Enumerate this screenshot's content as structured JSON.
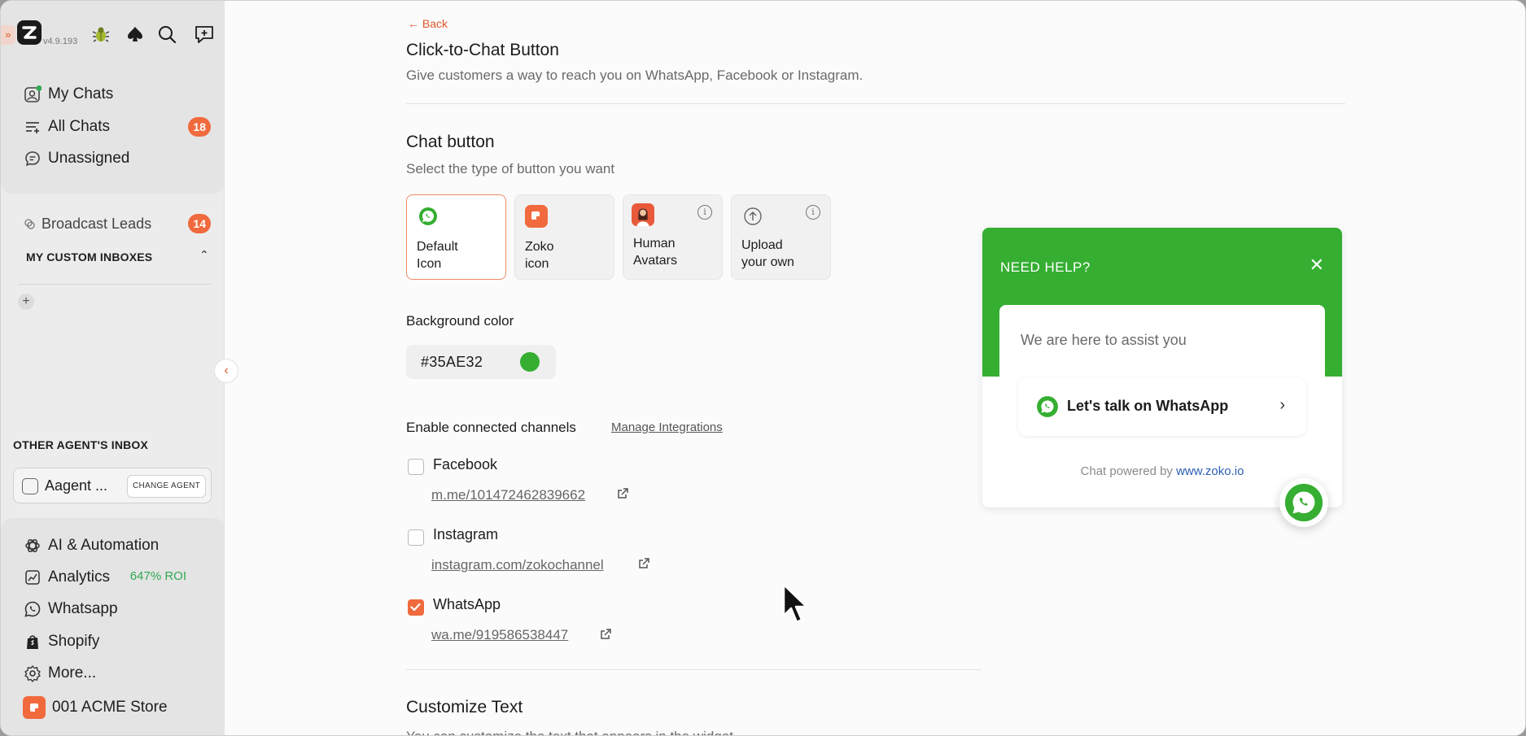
{
  "app": {
    "version": "v4.9.193"
  },
  "sidebar": {
    "primary": [
      {
        "label": "My Chats",
        "icon": "person-chat-icon"
      },
      {
        "label": "All Chats",
        "icon": "list-filter-icon",
        "badge": "18"
      },
      {
        "label": "Unassigned",
        "icon": "chat-bubble-icon"
      }
    ],
    "broadcast": {
      "label": "Broadcast Leads",
      "badge": "14"
    },
    "custom_inboxes_label": "MY CUSTOM INBOXES",
    "other_agent_label": "OTHER AGENT'S INBOX",
    "agent": {
      "name": "Aagent ...",
      "change_label": "CHANGE AGENT"
    },
    "bottom": [
      {
        "label": "AI & Automation",
        "icon": "openai-icon"
      },
      {
        "label": "Analytics",
        "icon": "chart-line-icon",
        "extra": "647% ROI"
      },
      {
        "label": "Whatsapp",
        "icon": "whatsapp-icon"
      },
      {
        "label": "Shopify",
        "icon": "shopify-bag-icon"
      },
      {
        "label": "More...",
        "icon": "gear-icon"
      }
    ],
    "store": {
      "label": "001 ACME Store"
    }
  },
  "page": {
    "back_label": "Back",
    "title": "Click-to-Chat Button",
    "subtitle": "Give customers a way to reach you on WhatsApp, Facebook or Instagram."
  },
  "chat_button": {
    "heading": "Chat button",
    "subheading": "Select the type of button you want",
    "types": [
      {
        "line1": "Default",
        "line2": "Icon",
        "selected": true
      },
      {
        "line1": "Zoko",
        "line2": "icon",
        "selected": false
      },
      {
        "line1": "Human",
        "line2": "Avatars",
        "selected": false
      },
      {
        "line1": "Upload",
        "line2": "your own",
        "selected": false
      }
    ]
  },
  "background": {
    "label": "Background color",
    "value": "#35AE32"
  },
  "channels": {
    "label": "Enable connected channels",
    "manage_label": "Manage Integrations",
    "items": [
      {
        "name": "Facebook",
        "link": "m.me/101472462839662",
        "checked": false
      },
      {
        "name": "Instagram",
        "link": "instagram.com/zokochannel",
        "checked": false
      },
      {
        "name": "WhatsApp",
        "link": "wa.me/919586538447",
        "checked": true
      }
    ]
  },
  "customize": {
    "heading": "Customize Text",
    "subheading": "You can customize the text that appears in the widget"
  },
  "widget": {
    "title": "NEED HELP?",
    "assist_text": "We are here to assist you",
    "cta": "Let's talk on WhatsApp",
    "powered_prefix": "Chat powered by",
    "powered_link": "www.zoko.io"
  },
  "colors": {
    "accent": "#f06a3d",
    "brand_green": "#35AE32"
  }
}
